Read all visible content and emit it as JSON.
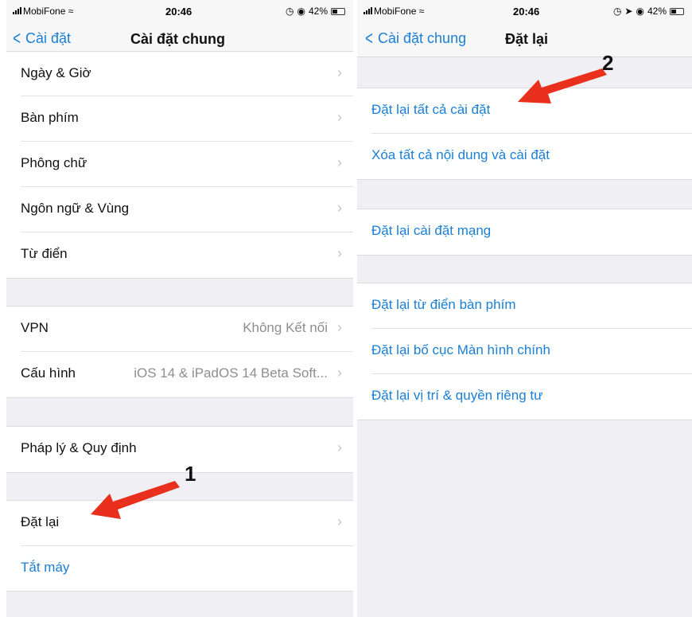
{
  "left": {
    "status": {
      "carrier": "MobiFone",
      "time": "20:46",
      "battery": "42%",
      "battery_level": 0.42
    },
    "nav": {
      "back_label": "Cài đặt",
      "title": "Cài đặt chung"
    },
    "group1": [
      {
        "label": "Ngày & Giờ"
      },
      {
        "label": "Bàn phím"
      },
      {
        "label": "Phông chữ"
      },
      {
        "label": "Ngôn ngữ & Vùng"
      },
      {
        "label": "Từ điển"
      }
    ],
    "group2": [
      {
        "label": "VPN",
        "value": "Không Kết nối"
      },
      {
        "label": "Cấu hình",
        "value": "iOS 14 & iPadOS 14 Beta Soft..."
      }
    ],
    "group3": [
      {
        "label": "Pháp lý & Quy định"
      }
    ],
    "group4": [
      {
        "label": "Đặt lại"
      },
      {
        "label": "Tắt máy"
      }
    ],
    "annotation_number": "1"
  },
  "right": {
    "status": {
      "carrier": "MobiFone",
      "time": "20:46",
      "battery": "42%",
      "battery_level": 0.42
    },
    "nav": {
      "back_label": "Cài đặt chung",
      "title": "Đặt lại"
    },
    "group1": [
      {
        "label": "Đặt lại tất cả cài đặt"
      },
      {
        "label": "Xóa tất cả nội dung và cài đặt"
      }
    ],
    "group2": [
      {
        "label": "Đặt lại cài đặt mạng"
      }
    ],
    "group3": [
      {
        "label": "Đặt lại từ điển bàn phím"
      },
      {
        "label": "Đặt lại bố cục Màn hình chính"
      },
      {
        "label": "Đặt lại vị trí & quyền riêng tư"
      }
    ],
    "annotation_number": "2"
  },
  "colors": {
    "link_blue": "#1a7fd6",
    "arrow_red": "#e8301c",
    "group_bg": "#efeff4"
  },
  "icons": [
    "signal-icon",
    "wifi-icon",
    "alarm-icon",
    "location-icon",
    "battery-icon",
    "back-chevron-icon",
    "row-chevron-icon"
  ]
}
